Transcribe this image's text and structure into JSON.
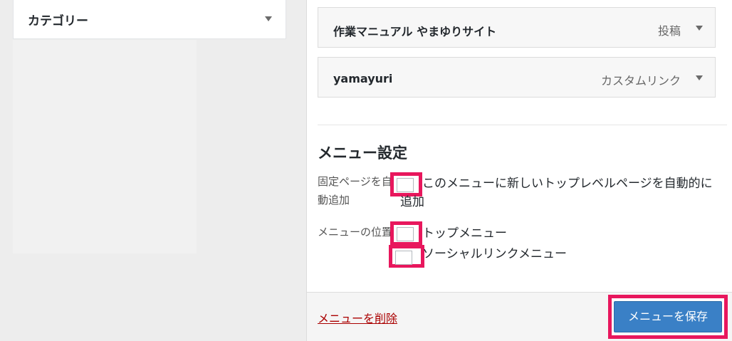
{
  "left_panel": {
    "category_box": {
      "title": "カテゴリー",
      "toggle_icon": "triangle-down-icon"
    }
  },
  "menu_items": [
    {
      "title": "作業マニュアル やまゆりサイト",
      "type": "投稿",
      "toggle_icon": "triangle-down-icon"
    },
    {
      "title": "yamayuri",
      "type": "カスタムリンク",
      "toggle_icon": "triangle-down-icon"
    }
  ],
  "menu_settings": {
    "title": "メニュー設定",
    "auto_add": {
      "label": "固定ページを自動追加",
      "option_text": "このメニューに新しいトップレベルページを自動的に追加",
      "checked": false
    },
    "location": {
      "label": "メニューの位置",
      "options": [
        {
          "text": "トップメニュー",
          "checked": false
        },
        {
          "text": "ソーシャルリンクメニュー",
          "checked": false
        }
      ]
    }
  },
  "footer": {
    "delete_label": "メニューを削除",
    "save_label": "メニューを保存"
  },
  "colors": {
    "highlight": "#e8175d",
    "primary_button": "#3a80c6",
    "delete_link": "#aa0000"
  }
}
